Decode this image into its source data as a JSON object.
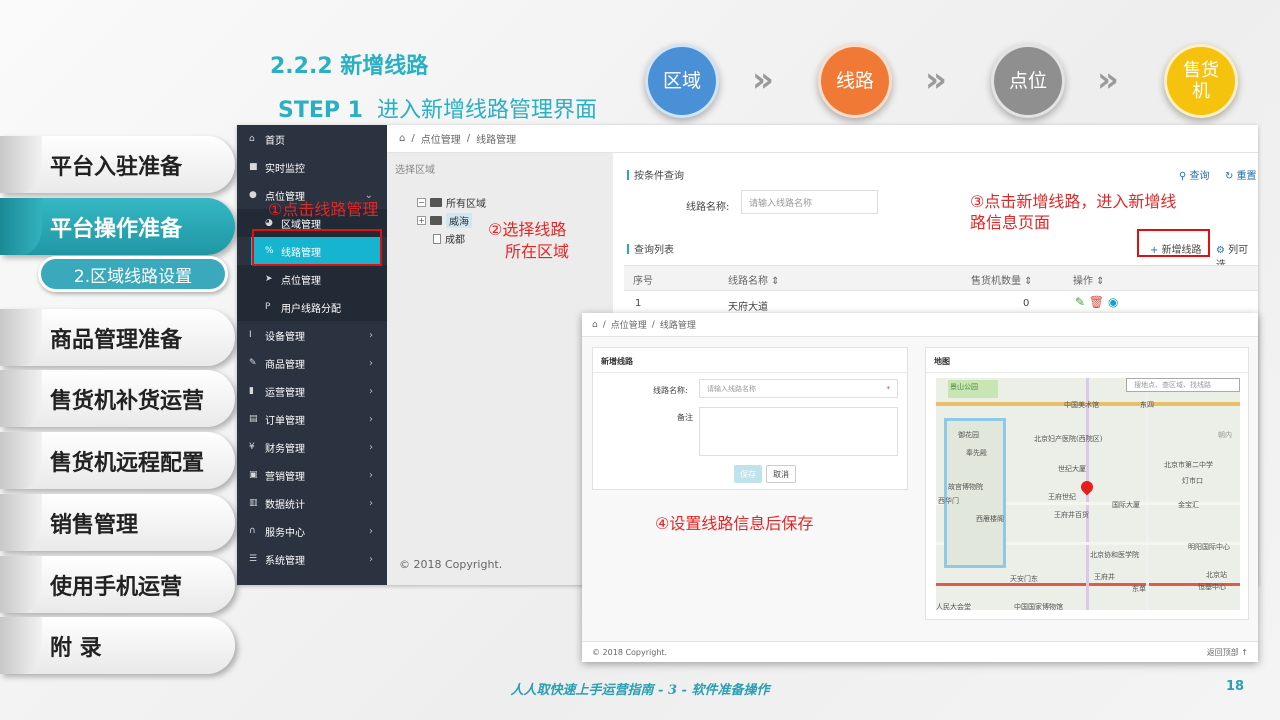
{
  "heading": "2.2.2 新增线路",
  "step": {
    "label": "STEP 1",
    "text": "进入新增线路管理界面"
  },
  "flow": [
    {
      "text": "区域",
      "color": "#4a90d6"
    },
    {
      "text": "线路",
      "color": "#f07a35"
    },
    {
      "text": "点位",
      "color": "#8f8f8f"
    },
    {
      "text": "售货机",
      "color": "#f5c20e"
    }
  ],
  "flow_arrow": "»",
  "nav": {
    "tabs": [
      "平台入驻准备",
      "平台操作准备",
      "商品管理准备",
      "售货机补货运营",
      "售货机远程配置",
      "销售管理",
      "使用手机运营",
      "附 录"
    ],
    "active_sub": "2.区域线路设置"
  },
  "admin": {
    "sidebar": [
      {
        "icon": "home-icon",
        "glyph": "⌂",
        "label": "首页"
      },
      {
        "icon": "video-icon",
        "glyph": "■",
        "label": "实时监控"
      },
      {
        "icon": "location-icon",
        "glyph": "●",
        "label": "点位管理",
        "arrow": "⌄"
      },
      {
        "icon": "region-icon",
        "glyph": "◕",
        "label": "区域管理"
      },
      {
        "icon": "route-icon",
        "glyph": "%",
        "label": "线路管理"
      },
      {
        "icon": "point-icon",
        "glyph": "➤",
        "label": "点位管理"
      },
      {
        "icon": "user-route-icon",
        "glyph": "P",
        "label": "用户线路分配"
      },
      {
        "icon": "device-icon",
        "glyph": "Ⅰ",
        "label": "设备管理",
        "arrow": "›"
      },
      {
        "icon": "goods-icon",
        "glyph": "✎",
        "label": "商品管理",
        "arrow": "›"
      },
      {
        "icon": "ops-icon",
        "glyph": "▮",
        "label": "运营管理",
        "arrow": "›"
      },
      {
        "icon": "order-icon",
        "glyph": "▤",
        "label": "订单管理",
        "arrow": "›"
      },
      {
        "icon": "finance-icon",
        "glyph": "¥",
        "label": "财务管理",
        "arrow": "›"
      },
      {
        "icon": "marketing-icon",
        "glyph": "▣",
        "label": "营销管理",
        "arrow": "›"
      },
      {
        "icon": "stats-icon",
        "glyph": "▥",
        "label": "数据统计",
        "arrow": "›"
      },
      {
        "icon": "service-icon",
        "glyph": "∩",
        "label": "服务中心",
        "arrow": "›"
      },
      {
        "icon": "system-icon",
        "glyph": "☰",
        "label": "系统管理",
        "arrow": "›"
      }
    ],
    "breadcrumb": [
      "点位管理",
      "线路管理"
    ],
    "region_title": "选择区域",
    "tree": {
      "root": "所有区域",
      "child1": "威海",
      "child2": "成都"
    },
    "query_title": "按条件查询",
    "query_btn": "查询",
    "reset_btn": "重置",
    "route_name_label": "线路名称:",
    "route_name_placeholder": "请输入线路名称",
    "list_title": "查询列表",
    "add_btn": "新增线路",
    "columns_btn": "列可选",
    "table_headers": [
      "序号",
      "线路名称 ⇕",
      "售货机数量 ⇕",
      "操作 ⇕"
    ],
    "rows": [
      {
        "no": "1",
        "name": "天府大道",
        "count": "0"
      }
    ],
    "footer": "© 2018 Copyright."
  },
  "newwin": {
    "breadcrumb": [
      "点位管理",
      "线路管理"
    ],
    "form_title": "新增线路",
    "name_label": "线路名称:",
    "name_placeholder": "请输入线路名称",
    "required_mark": "*",
    "remark_label": "备注",
    "save_btn": "保存",
    "cancel_btn": "取消",
    "map_title": "地图",
    "map_search_placeholder": "搜地点、查区域、找线路",
    "map_labels": [
      "景山公园",
      "中国美术馆",
      "东四",
      "朝内",
      "御花园",
      "北京妇产医院(西院区)",
      "奉先殿",
      "世纪大厦",
      "北京市第二中学",
      "灯市口",
      "故宫博物院",
      "王府世纪",
      "国际大厦",
      "金宝汇",
      "西华门",
      "王府井百货",
      "西雁楼阁",
      "明阳国际中心",
      "北京协和医学院",
      "北京站",
      "天安门东",
      "王府井",
      "东单",
      "恒基中心",
      "人民大会堂",
      "中国国家博物馆"
    ],
    "footer": "© 2018 Copyright.",
    "back_top": "返回顶部 ↑"
  },
  "notes": {
    "n1": "①点击线路管理",
    "n2a": "②选择线路",
    "n2b": "所在区域",
    "n3a": "③点击新增线路，进入新增线",
    "n3b": "路信息页面",
    "n4": "④设置线路信息后保存"
  },
  "footer_caption": "人人取快速上手运营指南 - 3 - 软件准备操作",
  "page_number": "18"
}
